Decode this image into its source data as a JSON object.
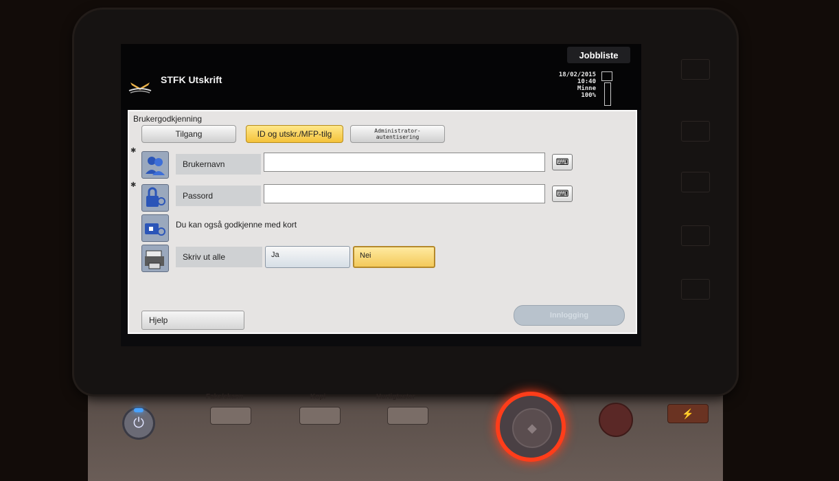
{
  "header": {
    "app_title": "STFK Utskrift",
    "job_list_label": "Jobbliste",
    "date": "18/02/2015",
    "time": "10:40",
    "memory_label": "Minne",
    "memory_value": "100%"
  },
  "auth": {
    "breadcrumb": "Brukergodkjenning",
    "tabs": [
      {
        "label": "Tilgang",
        "active": false
      },
      {
        "label": "ID og utskr./MFP-tilg",
        "active": true
      },
      {
        "label_line1": "Administrator-",
        "label_line2": "autentisering",
        "active": false
      }
    ],
    "username": {
      "label": "Brukernavn",
      "value": ""
    },
    "password": {
      "label": "Passord",
      "value": ""
    },
    "card_text": "Du kan også godkjenne med kort",
    "print_all": {
      "label": "Skriv ut alle",
      "yes": "Ja",
      "no": "Nei",
      "selected": "Nei"
    },
    "help_label": "Hjelp",
    "login_label": "Innlogging"
  },
  "hardware": {
    "keys": [
      "Faks/skann",
      "Kopi",
      "Hurtigtaster"
    ]
  }
}
